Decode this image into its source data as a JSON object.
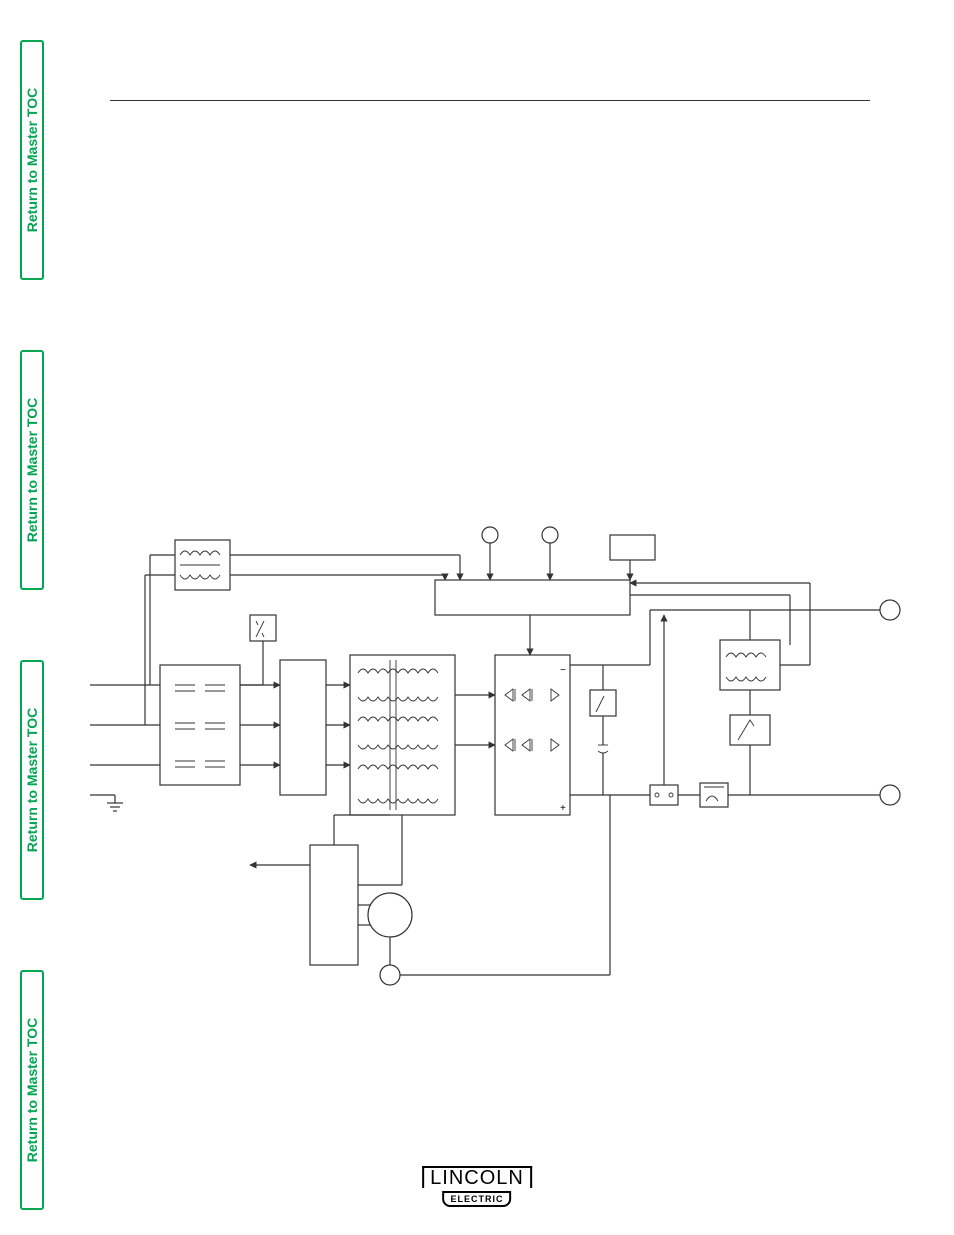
{
  "nav": {
    "toc_label": "Return to Master TOC"
  },
  "footer": {
    "logo_top": "LINCOLN",
    "logo_bottom": "ELECTRIC"
  },
  "diagram": {
    "type": "block-schematic",
    "title": "",
    "description": "Three-phase input through filter and rectifier, main transformer, output rectifier bridge, control/feedback board with two pots, DC link, output choke and shunt to positive and negative output terminals. Auxiliary transformer and fan motor driven from control board.",
    "blocks": [
      {
        "id": "input_filter",
        "label": ""
      },
      {
        "id": "rectifier_block",
        "label": ""
      },
      {
        "id": "aux_xfmr",
        "label": ""
      },
      {
        "id": "main_xfmr",
        "label": ""
      },
      {
        "id": "output_bridge",
        "label": ""
      },
      {
        "id": "control_board",
        "label": ""
      },
      {
        "id": "dc_cap",
        "label": ""
      },
      {
        "id": "choke",
        "label": ""
      },
      {
        "id": "shunt",
        "label": ""
      },
      {
        "id": "driver_board",
        "label": ""
      },
      {
        "id": "fan",
        "label": ""
      }
    ],
    "terminals": [
      {
        "id": "L1"
      },
      {
        "id": "L2"
      },
      {
        "id": "L3"
      },
      {
        "id": "GND"
      },
      {
        "id": "pot1"
      },
      {
        "id": "pot2"
      },
      {
        "id": "out_neg"
      },
      {
        "id": "out_pos"
      },
      {
        "id": "aux_out"
      },
      {
        "id": "feedback"
      }
    ],
    "polarity": {
      "bridge_top": "−",
      "bridge_bottom": "+"
    }
  }
}
